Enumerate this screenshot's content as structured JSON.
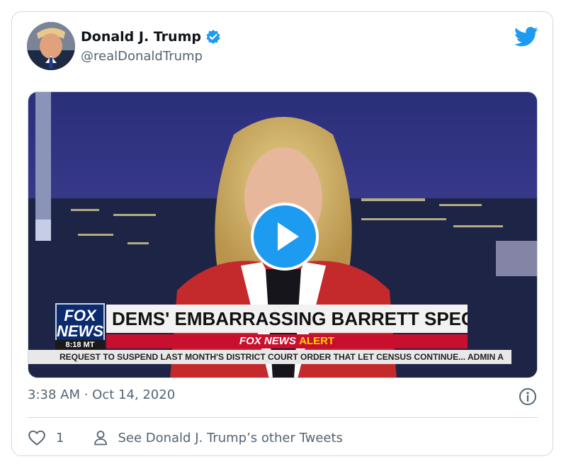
{
  "tweet": {
    "author_name": "Donald J. Trump",
    "author_handle": "@realDonaldTrump",
    "timestamp": "3:38 AM · Oct 14, 2020",
    "like_count": "1",
    "other_tweets_label": "See Donald J. Trump’s other Tweets"
  },
  "video": {
    "logo_line1": "FOX",
    "logo_line2": "NEWS",
    "clock": "8:18 MT",
    "headline": "DEMS' EMBARRASSING BARRETT SPECTACLE",
    "alert_prefix": "FOX NEWS",
    "alert_word": "ALERT",
    "ticker": "REQUEST TO SUSPEND LAST MONTH'S DISTRICT COURT ORDER THAT LET CENSUS CONTINUE...  ADMIN A"
  },
  "icons": {
    "brand": "twitter-bird-icon",
    "verified": "verified-badge-icon",
    "play": "play-icon",
    "info": "info-icon",
    "like": "heart-icon",
    "profile": "person-icon"
  },
  "colors": {
    "accent": "#1d9bf0",
    "text_primary": "#0f1419",
    "text_secondary": "#536471",
    "border": "#cfd9de"
  }
}
